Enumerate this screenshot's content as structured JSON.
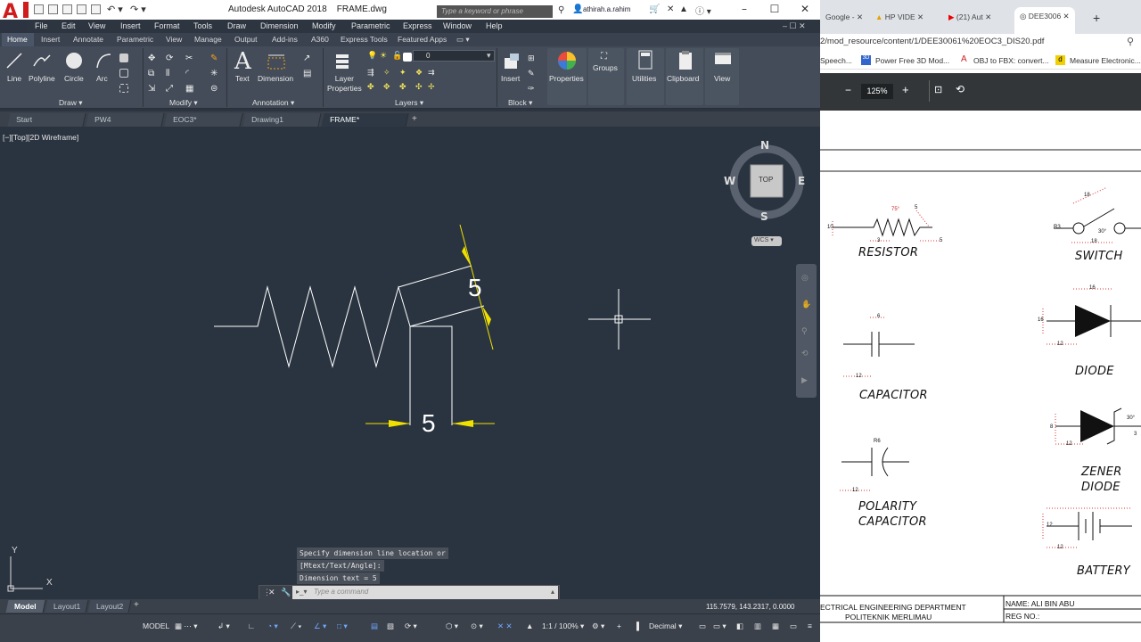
{
  "autocad": {
    "title": "Autodesk AutoCAD 2018",
    "filename": "FRAME.dwg",
    "search_placeholder": "Type a keyword or phrase",
    "user": "athirah.a.rahim",
    "menu": [
      "File",
      "Edit",
      "View",
      "Insert",
      "Format",
      "Tools",
      "Draw",
      "Dimension",
      "Modify",
      "Parametric",
      "Express",
      "Window",
      "Help"
    ],
    "ribbon_tabs": [
      "Home",
      "Insert",
      "Annotate",
      "Parametric",
      "View",
      "Manage",
      "Output",
      "Add-ins",
      "A360",
      "Express Tools",
      "Featured Apps"
    ],
    "draw_tools": [
      "Line",
      "Polyline",
      "Circle",
      "Arc"
    ],
    "text_tool": "Text",
    "dimension_tool": "Dimension",
    "layer_properties": "Layer Properties",
    "layer_current": "0",
    "insert_tool": "Insert",
    "big_tools": [
      "Properties",
      "Groups",
      "Utilities",
      "Clipboard",
      "View"
    ],
    "panels": [
      "Draw",
      "Modify",
      "Annotation",
      "Layers",
      "Block"
    ],
    "doc_tabs": [
      "Start",
      "PW4",
      "EOC3*",
      "Drawing1",
      "FRAME*"
    ],
    "viewport_label": "[−][Top][2D Wireframe]",
    "viewcube": {
      "n": "N",
      "s": "S",
      "e": "E",
      "w": "W",
      "top": "TOP",
      "wcs": "WCS"
    },
    "dim_text_1": "5",
    "dim_text_2": "5",
    "ucs_x": "X",
    "ucs_y": "Y",
    "command_history": [
      "Specify dimension line location or",
      "[Mtext/Text/Angle]:",
      "Dimension text = 5"
    ],
    "command_placeholder": "Type a command",
    "layout_tabs": [
      "Model",
      "Layout1",
      "Layout2"
    ],
    "coordinates": "115.7579, 143.2317, 0.0000",
    "status": {
      "model": "MODEL",
      "scale": "1:1 / 100%",
      "units": "Decimal"
    }
  },
  "chrome": {
    "tabs": [
      "Google -",
      "HP VIDE",
      "(21) Aut",
      "DEE3006"
    ],
    "url": "2/mod_resource/content/1/DEE30061%20EOC3_DIS20.pdf",
    "bookmarks": [
      "Speech...",
      "Power Free 3D Mod...",
      "OBJ to FBX: convert...",
      "Measure Electronic..."
    ],
    "zoom": "125%",
    "labels": {
      "resistor": "RESISTOR",
      "switch": "SWITCH",
      "capacitor": "CAPACITOR",
      "diode": "DIODE",
      "zener1": "ZENER",
      "zener2": "DIODE",
      "polarity1": "POLARITY",
      "polarity2": "CAPACITOR",
      "battery": "BATTERY"
    },
    "dims": {
      "r_angle": "75°",
      "r5": "5",
      "r10": "10",
      "r3": "3",
      "r5b": "5",
      "s18": "18",
      "sr3": "R3",
      "s30": "30°",
      "s18b": "18",
      "c6": "6",
      "c12": "12",
      "d16": "16",
      "d12": "12",
      "d16b": "16",
      "z30": "30°",
      "z12": "12",
      "z8": "8",
      "z3": "3",
      "pr6": "R6",
      "p12": "12",
      "b12": "12",
      "b12b": "12"
    },
    "footer_dept": "ECTRICAL ENGINEERING DEPARTMENT",
    "footer_poly": "POLITEKNIK MERLIMAU",
    "footer_name": "NAME: ALI BIN ABU",
    "footer_reg": "REG NO.:"
  }
}
